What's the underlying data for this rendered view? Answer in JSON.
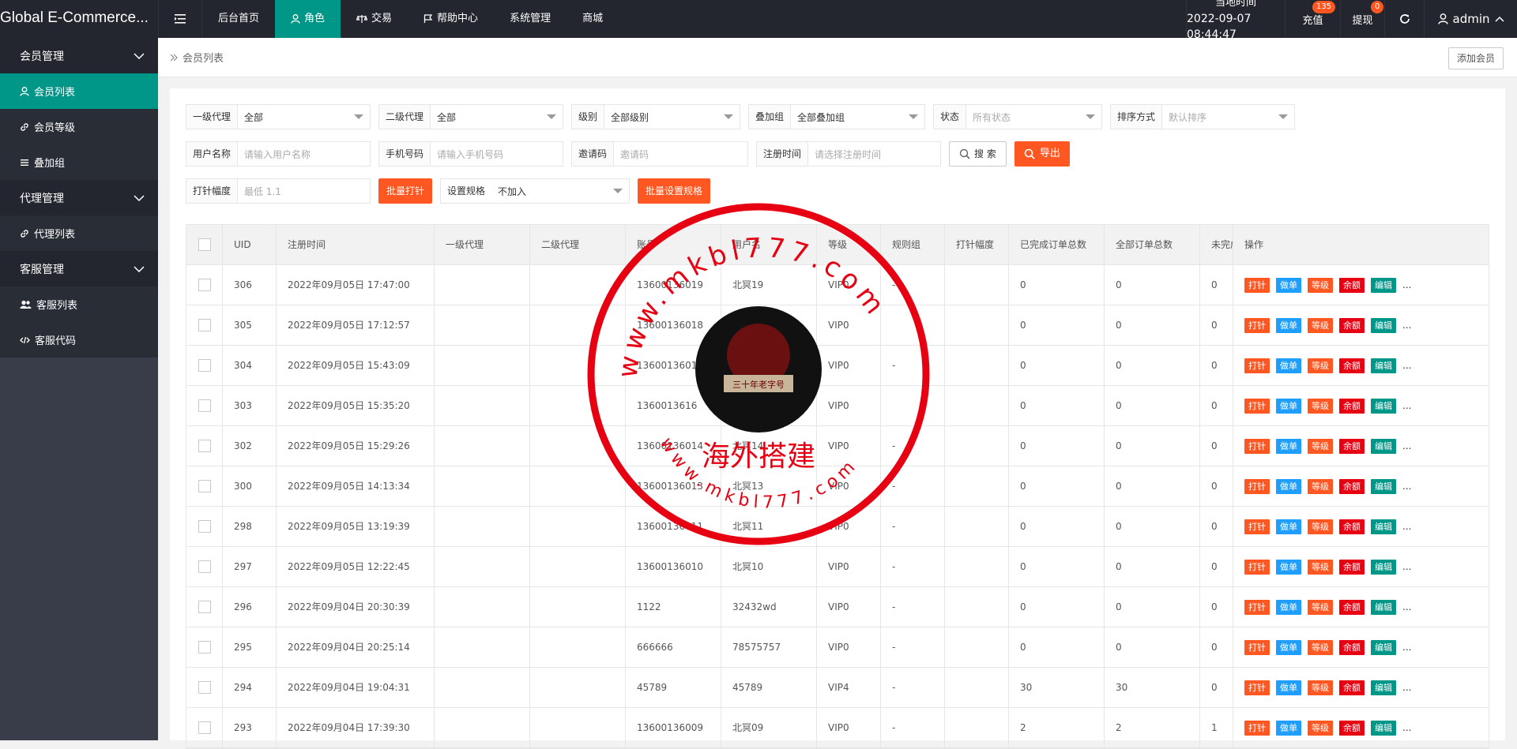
{
  "app": {
    "brand": "Global E-Commerce..."
  },
  "nav": [
    {
      "label": "后台首页",
      "icon": ""
    },
    {
      "label": "角色",
      "icon": "user-icon"
    },
    {
      "label": "交易",
      "icon": "scale-icon"
    },
    {
      "label": "帮助中心",
      "icon": "flag-icon"
    },
    {
      "label": "系统管理",
      "icon": ""
    },
    {
      "label": "商城",
      "icon": ""
    }
  ],
  "topright": {
    "clock_label": "当地时间",
    "clock_value": "2022-09-07 08:44:47",
    "recharge": "充值",
    "recharge_badge": "135",
    "withdraw": "提现",
    "withdraw_badge": "0",
    "user": "admin"
  },
  "sidebar": [
    {
      "type": "group",
      "label": "会员管理"
    },
    {
      "type": "item",
      "label": "会员列表",
      "icon": "user-icon",
      "active": true
    },
    {
      "type": "item",
      "label": "会员等级",
      "icon": "link-icon"
    },
    {
      "type": "item",
      "label": "叠加组",
      "icon": "list-icon"
    },
    {
      "type": "group",
      "label": "代理管理"
    },
    {
      "type": "item",
      "label": "代理列表",
      "icon": "link-icon"
    },
    {
      "type": "group",
      "label": "客服管理"
    },
    {
      "type": "item",
      "label": "客服列表",
      "icon": "users-icon"
    },
    {
      "type": "item",
      "label": "客服代码",
      "icon": "code-icon"
    }
  ],
  "breadcrumb": "会员列表",
  "add_member": "添加会员",
  "filters": {
    "row1": [
      {
        "label": "一级代理",
        "value": "全部",
        "w": 190,
        "select": true,
        "ph": false
      },
      {
        "label": "二级代理",
        "value": "全部",
        "w": 190,
        "select": true,
        "ph": false
      },
      {
        "label": "级别",
        "value": "全部级别",
        "w": 170,
        "select": true,
        "ph": false
      },
      {
        "label": "叠加组",
        "value": "全部叠加组",
        "w": 180,
        "select": true,
        "ph": false
      },
      {
        "label": "状态",
        "value": "所有状态",
        "w": 170,
        "select": true,
        "ph": true
      },
      {
        "label": "排序方式",
        "value": "默认排序",
        "w": 190,
        "select": true,
        "ph": true
      }
    ],
    "row2": [
      {
        "label": "用户名称",
        "value": "请输入用户名称",
        "w": 190,
        "select": false,
        "ph": true
      },
      {
        "label": "手机号码",
        "value": "请输入手机号码",
        "w": 190,
        "select": false,
        "ph": true
      },
      {
        "label": "邀请码",
        "value": "邀请码",
        "w": 180,
        "select": false,
        "ph": true
      },
      {
        "label": "注册时间",
        "value": "请选择注册时间",
        "w": 190,
        "select": false,
        "ph": true
      }
    ],
    "search": "搜 索",
    "export": "导出",
    "row3": {
      "label": "打针幅度",
      "placeholder": "最低 1.1",
      "batch_pin": "批量打针",
      "rule_label": "设置规格",
      "rule_value": "不加入",
      "batch_rule": "批量设置规格"
    }
  },
  "table": {
    "columns": [
      "UID",
      "注册时间",
      "一级代理",
      "二级代理",
      "账号",
      "用户名",
      "等级",
      "规则组",
      "打针幅度",
      "已完成订单总数",
      "全部订单总数",
      "未完成",
      "操作"
    ],
    "ops": [
      "打针",
      "做单",
      "等级",
      "余额",
      "编辑",
      "..."
    ],
    "rows": [
      {
        "uid": "306",
        "time": "2022年09月05日 17:47:00",
        "a1": "",
        "a2": "",
        "acct": "13600136019",
        "name": "北冥19",
        "lvl": "VIP0",
        "rule": "-",
        "pin": "",
        "done": "0",
        "all": "0",
        "undone": "0"
      },
      {
        "uid": "305",
        "time": "2022年09月05日 17:12:57",
        "a1": "",
        "a2": "",
        "acct": "13600136018",
        "name": "",
        "lvl": "VIP0",
        "rule": "",
        "pin": "",
        "done": "0",
        "all": "0",
        "undone": "0"
      },
      {
        "uid": "304",
        "time": "2022年09月05日 15:43:09",
        "a1": "",
        "a2": "",
        "acct": "1360013601",
        "name": "",
        "lvl": "VIP0",
        "rule": "-",
        "pin": "",
        "done": "0",
        "all": "0",
        "undone": "0"
      },
      {
        "uid": "303",
        "time": "2022年09月05日 15:35:20",
        "a1": "",
        "a2": "",
        "acct": "1360013616",
        "name": "",
        "lvl": "VIP0",
        "rule": "",
        "pin": "",
        "done": "0",
        "all": "0",
        "undone": "0"
      },
      {
        "uid": "302",
        "time": "2022年09月05日 15:29:26",
        "a1": "",
        "a2": "",
        "acct": "13600136014",
        "name": "北冥14",
        "lvl": "VIP0",
        "rule": "-",
        "pin": "",
        "done": "0",
        "all": "0",
        "undone": "0"
      },
      {
        "uid": "300",
        "time": "2022年09月05日 14:13:34",
        "a1": "",
        "a2": "",
        "acct": "13600136013",
        "name": "北冥13",
        "lvl": "VIP0",
        "rule": "-",
        "pin": "",
        "done": "0",
        "all": "0",
        "undone": "0"
      },
      {
        "uid": "298",
        "time": "2022年09月05日 13:19:39",
        "a1": "",
        "a2": "",
        "acct": "13600136011",
        "name": "北冥11",
        "lvl": "VIP0",
        "rule": "-",
        "pin": "",
        "done": "0",
        "all": "0",
        "undone": "0"
      },
      {
        "uid": "297",
        "time": "2022年09月05日 12:22:45",
        "a1": "",
        "a2": "",
        "acct": "13600136010",
        "name": "北冥10",
        "lvl": "VIP0",
        "rule": "-",
        "pin": "",
        "done": "0",
        "all": "0",
        "undone": "0"
      },
      {
        "uid": "296",
        "time": "2022年09月04日 20:30:39",
        "a1": "",
        "a2": "",
        "acct": "1122",
        "name": "32432wd",
        "lvl": "VIP0",
        "rule": "-",
        "pin": "",
        "done": "0",
        "all": "0",
        "undone": "0"
      },
      {
        "uid": "295",
        "time": "2022年09月04日 20:25:14",
        "a1": "",
        "a2": "",
        "acct": "666666",
        "name": "78575757",
        "lvl": "VIP0",
        "rule": "-",
        "pin": "",
        "done": "0",
        "all": "0",
        "undone": "0"
      },
      {
        "uid": "294",
        "time": "2022年09月04日 19:04:31",
        "a1": "",
        "a2": "",
        "acct": "45789",
        "name": "45789",
        "lvl": "VIP4",
        "rule": "-",
        "pin": "",
        "done": "30",
        "all": "30",
        "undone": "0"
      },
      {
        "uid": "293",
        "time": "2022年09月04日 17:39:30",
        "a1": "",
        "a2": "",
        "acct": "13600136009",
        "name": "北冥09",
        "lvl": "VIP0",
        "rule": "-",
        "pin": "",
        "done": "2",
        "all": "2",
        "undone": "1"
      }
    ]
  },
  "watermark": {
    "url_top": "www.mkbl777.com",
    "text_cn": "海外搭建",
    "url_bottom": "www.mkbl777.com",
    "badge_text": "三十年老字号"
  },
  "colors": {
    "accent": "#009688",
    "orange": "#ff5722",
    "blue": "#1e9fff",
    "red": "#e60012",
    "dark": "#23262e",
    "stamp": "#e60012"
  }
}
